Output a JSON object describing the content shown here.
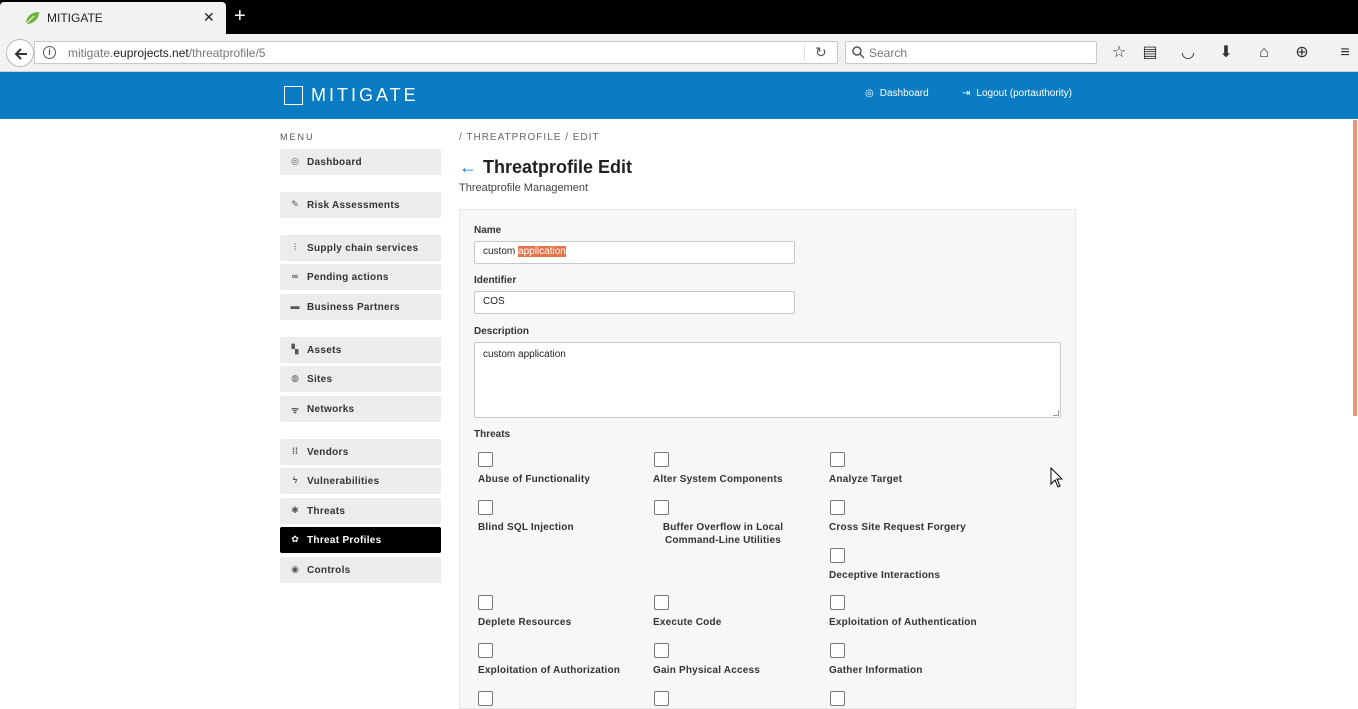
{
  "browser": {
    "tab_title": "MITIGATE",
    "url_prefix": "mitigate.",
    "url_domain": "euprojects.net",
    "url_path": "/threatprofile/5",
    "search_placeholder": "Search"
  },
  "header": {
    "logo": "MITIGATE",
    "dashboard_link": "Dashboard",
    "logout_link": "Logout (portauthority)",
    "color": "#0a7cc4"
  },
  "sidebar": {
    "title": "MENU",
    "items": [
      {
        "label": "Dashboard",
        "icon": "dashboard-icon"
      },
      {
        "label": "Risk Assessments",
        "icon": "wrench-icon"
      },
      {
        "label": "Supply chain services",
        "icon": "chain-icon"
      },
      {
        "label": "Pending actions",
        "icon": "link-icon"
      },
      {
        "label": "Business Partners",
        "icon": "briefcase-icon"
      },
      {
        "label": "Assets",
        "icon": "assets-icon"
      },
      {
        "label": "Sites",
        "icon": "globe-icon"
      },
      {
        "label": "Networks",
        "icon": "wifi-icon"
      },
      {
        "label": "Vendors",
        "icon": "grid-icon"
      },
      {
        "label": "Vulnerabilities",
        "icon": "bolt-icon"
      },
      {
        "label": "Threats",
        "icon": "bug-icon"
      },
      {
        "label": "Threat Profiles",
        "icon": "profile-icon",
        "active": true
      },
      {
        "label": "Controls",
        "icon": "eye-icon"
      }
    ]
  },
  "main": {
    "breadcrumb": "/ THREATPROFILE / EDIT",
    "title": "Threatprofile Edit",
    "subtitle": "Threatprofile Management",
    "form": {
      "name_label": "Name",
      "name_value_plain": "custom ",
      "name_value_selected": "application",
      "identifier_label": "Identifier",
      "identifier_value": "COS",
      "description_label": "Description",
      "description_value": "custom application",
      "threats_label": "Threats",
      "threats": [
        "Abuse of Functionality",
        "Alter System Components",
        "Analyze Target",
        "Blind SQL Injection",
        "Buffer Overflow in Local Command-Line Utilities",
        "Cross Site Request Forgery",
        "Deceptive Interactions",
        "Deplete Resources",
        "Execute Code",
        "Exploitation of Authentication",
        "Exploitation of Authorization",
        "Gain Physical Access",
        "Gather Information"
      ]
    }
  }
}
